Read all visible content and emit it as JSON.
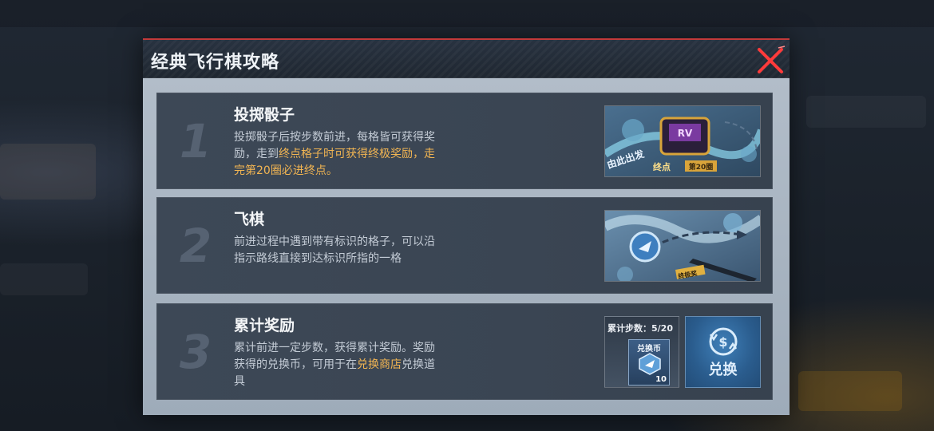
{
  "modal": {
    "title": "经典飞行棋攻略"
  },
  "steps": [
    {
      "number": "1",
      "title": "投掷骰子",
      "desc_parts": [
        "投掷骰子后按步数前进，每格皆可获得奖励，走到",
        "终点格子时可获得终极奖励",
        "，走完第20圈必进终点。"
      ],
      "image_texts": [
        "由此出发",
        "终点",
        "第20圈"
      ]
    },
    {
      "number": "2",
      "title": "飞棋",
      "desc": "前进过程中遇到带有标识的格子，可以沿指示路线直接到达标识所指的一格",
      "image_texts": [
        "终极奖"
      ]
    },
    {
      "number": "3",
      "title": "累计奖励",
      "desc_parts": [
        "累计前进一定步数，获得累计奖励。奖励获得的兑换币，可用于在",
        "兑换商店",
        "兑换道具"
      ],
      "steps_label": "累计步数：5/20",
      "coin_label": "兑换币",
      "coin_count": "10",
      "exchange_label": "兑换"
    }
  ],
  "colors": {
    "accent_red": "#c23a3a",
    "highlight": "#f2b552",
    "card_bg": "#3d4856"
  }
}
